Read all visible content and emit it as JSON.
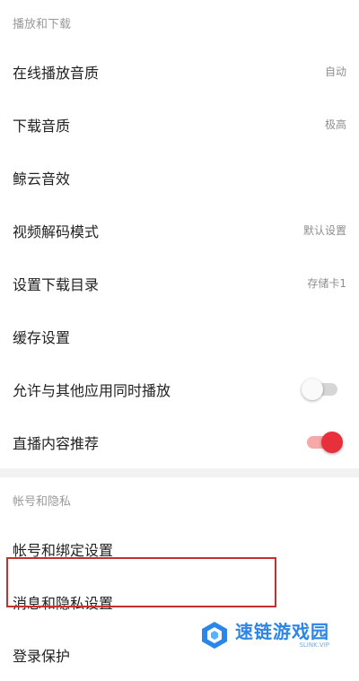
{
  "sections": {
    "playback": {
      "title": "播放和下载",
      "items": [
        {
          "label": "在线播放音质",
          "value": "自动"
        },
        {
          "label": "下载音质",
          "value": "极高"
        },
        {
          "label": "鲸云音效"
        },
        {
          "label": "视频解码模式",
          "value": "默认设置"
        },
        {
          "label": "设置下载目录",
          "value": "存储卡1"
        },
        {
          "label": "缓存设置"
        },
        {
          "label": "允许与其他应用同时播放",
          "toggle": "off"
        },
        {
          "label": "直播内容推荐",
          "toggle": "on"
        }
      ]
    },
    "account": {
      "title": "帐号和隐私",
      "items": [
        {
          "label": "帐号和绑定设置"
        },
        {
          "label": "消息和隐私设置",
          "highlighted": true
        },
        {
          "label": "登录保护"
        }
      ]
    }
  },
  "watermark": {
    "text": "速链游戏园",
    "sub": "SLINK.VIP"
  },
  "colors": {
    "accent": "#e8303a",
    "highlight_border": "#c5302d",
    "watermark": "#2a86e8"
  }
}
